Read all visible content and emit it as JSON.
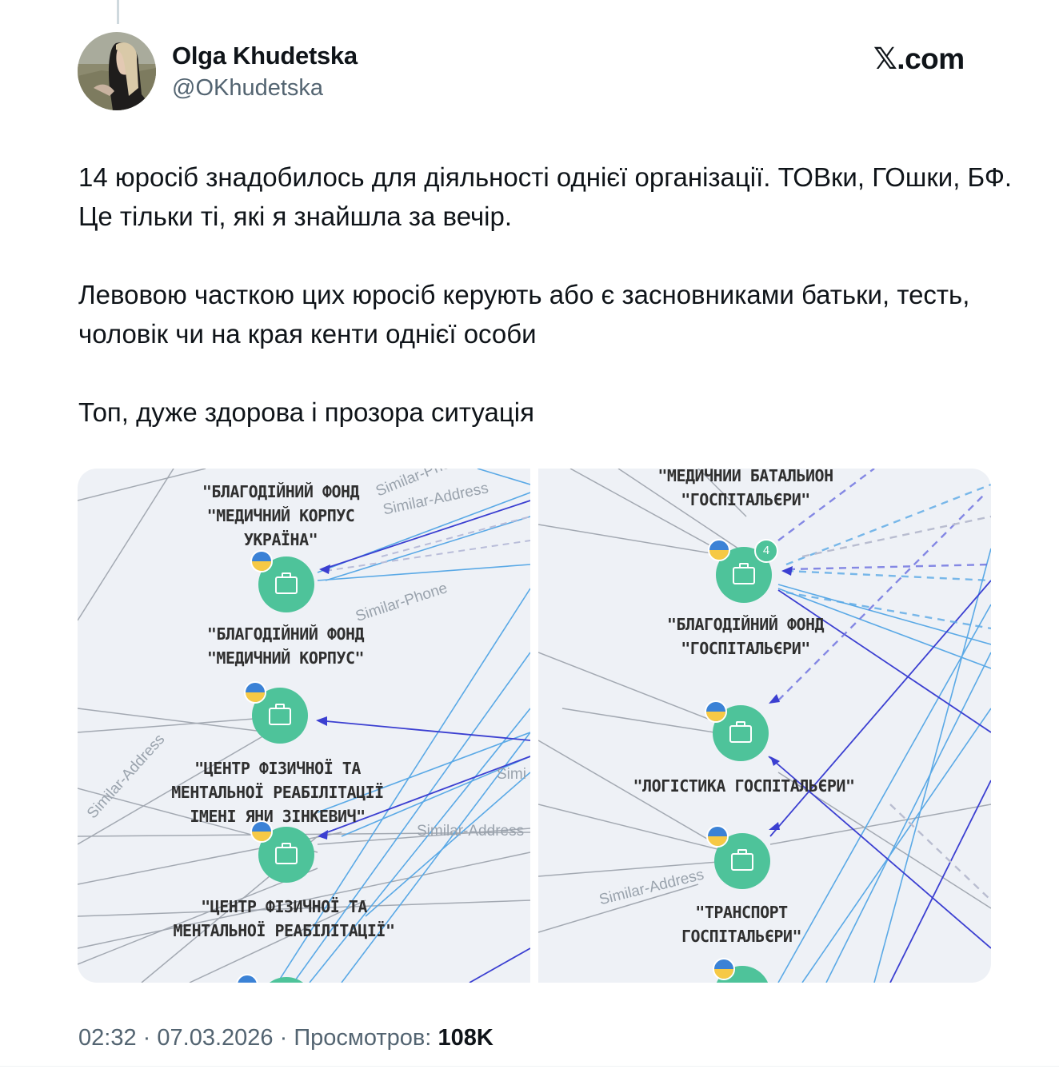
{
  "tweet": {
    "author_name": "Olga Khudetska",
    "author_handle": "@OKhudetska",
    "brand": "𝕏.com",
    "paragraphs": [
      "14 юросіб знадобилось для діяльності однієї організації. ТОВки, ГОшки, БФ. Це тільки ті, які я знайшла за вечір.",
      "Левовою часткою цих юросіб керують або є засновниками батьки, тесть, чоловік чи на края кенти однієї особи",
      "Топ, дуже здорова і прозора ситуація"
    ],
    "time": "02:32",
    "separator": "·",
    "date": "07.03.2026",
    "views_label": "Просмотров:",
    "views_count": "108K"
  },
  "media": {
    "left_panel": {
      "labels": [
        "\"БЛАГОДІЙНИЙ ФОНД\n\"МЕДИЧНИЙ КОРПУС\nУКРАЇНА\"",
        "\"БЛАГОДІЙНИЙ ФОНД\n\"МЕДИЧНИЙ КОРПУС\"",
        "\"ЦЕНТР ФІЗИЧНОЇ ТА\nМЕНТАЛЬНОЇ РЕАБІЛІТАЦІЇ\nІМЕНІ ЯНИ ЗІНКЕВИЧ\"",
        "\"ЦЕНТР ФІЗИЧНОЇ ТА\nМЕНТАЛЬНОЇ РЕАБІЛІТАЦІЇ\""
      ],
      "edge_labels": [
        "Similar-Phone",
        "Similar-Address",
        "Similar-Phone",
        "Similar-Address",
        "Similar-Address",
        "Simi"
      ]
    },
    "right_panel": {
      "labels": [
        "\"МЕДИЧНИЙ БАТАЛЬЙОН\n\"ГОСПІТАЛЬЄРИ\"",
        "\"БЛАГОДІЙНИЙ ФОНД\n\"ГОСПІТАЛЬЄРИ\"",
        "\"ЛОГІСТИКА ГОСПІТАЛЬЄРИ\"",
        "\"ТРАНСПОРТ\nГОСПІТАЛЬЄРИ\""
      ],
      "badge": "4",
      "edge_labels": [
        "Similar-Address"
      ]
    }
  },
  "colors": {
    "node": "#4ec39a",
    "edge_gray": "#9aa1ab",
    "edge_light_blue": "#5aa9e6",
    "edge_dark_blue": "#3b3fd1",
    "flag_blue": "#3b82d6",
    "flag_yellow": "#f6c945"
  }
}
